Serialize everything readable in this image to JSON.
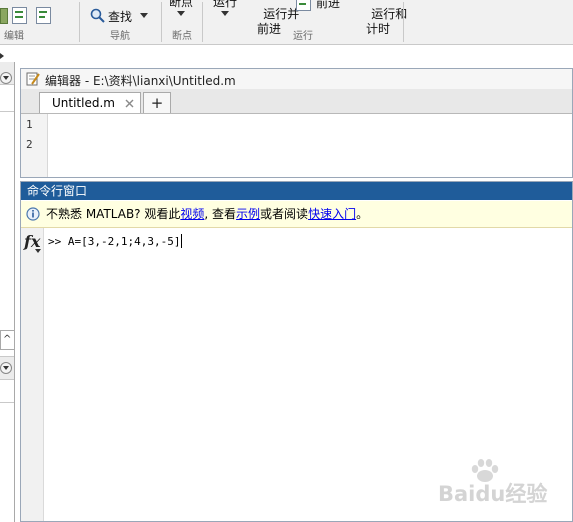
{
  "toolstrip": {
    "search_label": "查找",
    "breakpoints_label": "断点",
    "run_label": "运行",
    "run_advance_label": "运行并\n前进",
    "advance_label": "前进",
    "run_time_label": "运行和\n计时",
    "sections": [
      "编辑",
      "导航",
      "断点",
      "运行"
    ]
  },
  "editor": {
    "title": "编辑器 - E:\\资料\\lianxi\\Untitled.m",
    "tab_label": "Untitled.m",
    "add_tab_symbol": "+",
    "line_numbers": [
      "1",
      "2"
    ]
  },
  "command_window": {
    "title": "命令行窗口",
    "info_prefix": "不熟悉 MATLAB? 观看此",
    "info_link_video": "视频",
    "info_mid1": ", 查看",
    "info_link_examples": "示例",
    "info_mid2": "或者阅读",
    "info_link_getting_started": "快速入门",
    "info_suffix": "。",
    "fx_label": "fx",
    "prompt": ">>",
    "command_text": "A=[3,-2,1;4,3,-5]"
  },
  "watermark": {
    "text": "Baidu经验"
  },
  "colors": {
    "command_titlebar": "#1f5c9a",
    "info_bar": "#ffffe1",
    "link": "#0000ee"
  }
}
